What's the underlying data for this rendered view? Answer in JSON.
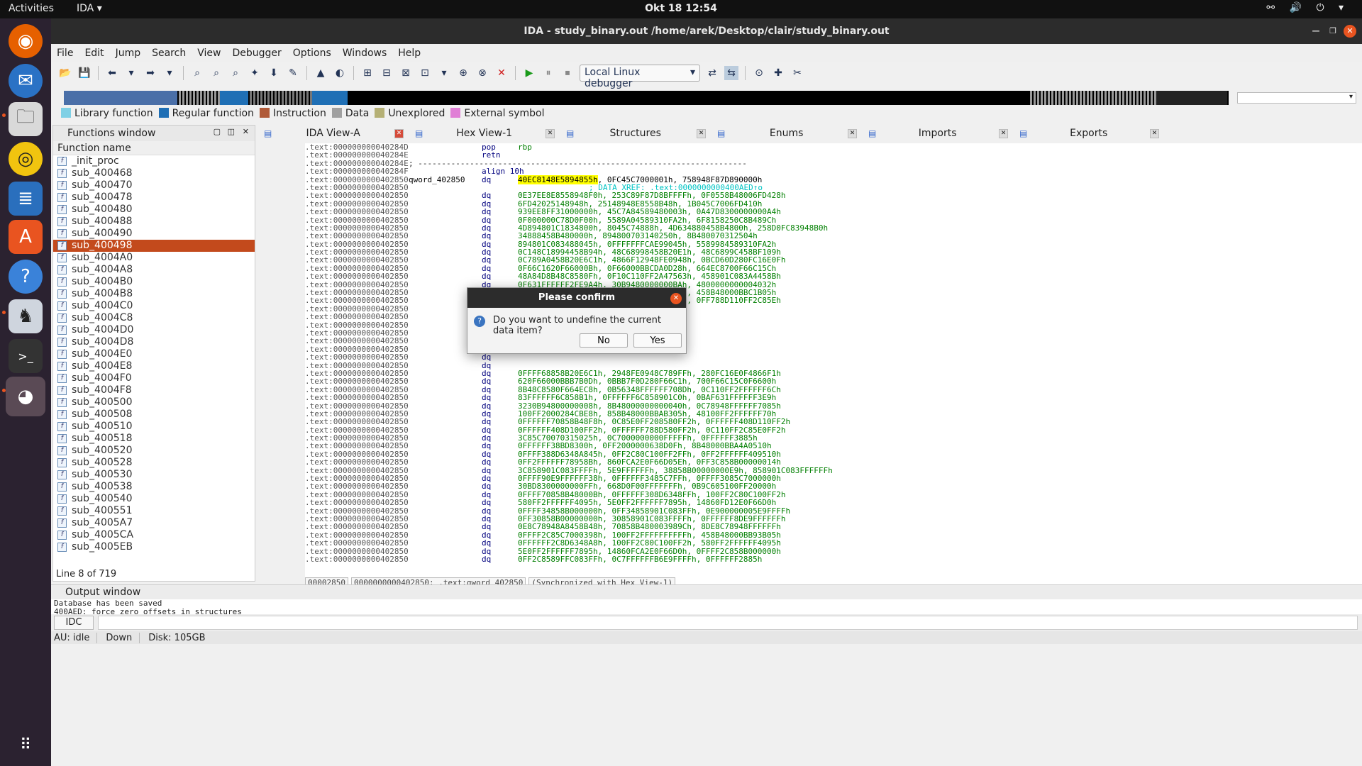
{
  "topbar": {
    "activities": "Activities",
    "app": "IDA ▾",
    "clock": "Okt 18  12:54",
    "tray": "⚯ 🔊 ⏻ ▾"
  },
  "window": {
    "title": "IDA - study_binary.out /home/arek/Desktop/clair/study_binary.out"
  },
  "menu": [
    "File",
    "Edit",
    "Jump",
    "Search",
    "View",
    "Debugger",
    "Options",
    "Windows",
    "Help"
  ],
  "toolbar": {
    "debugger": "Local Linux debugger"
  },
  "legend": [
    {
      "label": "Library function",
      "color": "#7fd0e5"
    },
    {
      "label": "Regular function",
      "color": "#1f6fb5"
    },
    {
      "label": "Instruction",
      "color": "#b05a38"
    },
    {
      "label": "Data",
      "color": "#a0a0a0"
    },
    {
      "label": "Unexplored",
      "color": "#b5b075"
    },
    {
      "label": "External symbol",
      "color": "#e07fd6"
    }
  ],
  "functions": {
    "title": "Functions window",
    "column": "Function name",
    "items": [
      "_init_proc",
      "sub_400468",
      "sub_400470",
      "sub_400478",
      "sub_400480",
      "sub_400488",
      "sub_400490",
      "sub_400498",
      "sub_4004A0",
      "sub_4004A8",
      "sub_4004B0",
      "sub_4004B8",
      "sub_4004C0",
      "sub_4004C8",
      "sub_4004D0",
      "sub_4004D8",
      "sub_4004E0",
      "sub_4004E8",
      "sub_4004F0",
      "sub_4004F8",
      "sub_400500",
      "sub_400508",
      "sub_400510",
      "sub_400518",
      "sub_400520",
      "sub_400528",
      "sub_400530",
      "sub_400538",
      "sub_400540",
      "sub_400551",
      "sub_4005A7",
      "sub_4005CA",
      "sub_4005EB"
    ],
    "selected_index": 7,
    "status": "Line 8 of 719"
  },
  "tabs": [
    {
      "label": "IDA View-A",
      "active": true
    },
    {
      "label": "Hex View-1",
      "active": false
    },
    {
      "label": "Structures",
      "active": false
    },
    {
      "label": "Enums",
      "active": false
    },
    {
      "label": "Imports",
      "active": false
    },
    {
      "label": "Exports",
      "active": false
    }
  ],
  "disasm": {
    "head": [
      {
        "addr": ".text:000000000040284D",
        "lab": "",
        "mn": "pop",
        "op": "rbp"
      },
      {
        "addr": ".text:000000000040284E",
        "lab": "",
        "mn": "retn",
        "op": ""
      },
      {
        "addr": ".text:000000000040284E",
        "lab": "",
        "mn": "; ----------------------------------------------------------------------",
        "op": ""
      },
      {
        "addr": ".text:000000000040284F",
        "lab": "",
        "mn": "align 10h",
        "op": ""
      }
    ],
    "qword_label": "qword_402850",
    "qword_addr": ".text:0000000000402850",
    "qword_first_hl": "40EC8148E5894855h",
    "qword_first_rest": ", 0FC45C7000001h, 758948F87D890000h",
    "xref": "; DATA XREF: .text:0000000000400AED↑o",
    "dq_addr": ".text:0000000000402850",
    "dq_lines": [
      "0E37EE8E8558948F0h, 253C89F87D8BFFFFh, 0F0558B48006FD428h",
      "6FD42025148948h, 25148948E8558B48h, 1B045C7006FD410h",
      "939EE8FF31000000h, 45C7A84589480003h, 0A47D8300000000A4h",
      "0F000000C78D0F00h, 5589A04589310FA2h, 6F8158250C8B489Ch",
      "4D894801C1834800h, 8045C74888h, 4D634880458B4800h, 258D0FC83948B0h",
      "34888458B480000h, 894800703140250h, 8B480070312504h",
      "894801C083488045h, 0FFFFFFFCAE99045h, 5589984589310FA2h",
      "0C148C18994458B94h, 48C68998458B20E1h, 48C6899C458BF109h",
      "0C789A0458B20E6C1h, 4866F12948FE0948h, 0BCD60D280FC16E0Fh",
      "0F66C1620F66000Bh, 0F66000BBCDA0D28h, 664EC8700F66C15Ch",
      "48A84D8B48C8580Fh, 0F10C110FF2A47563h, 458901C083A4458Bh",
      "0F631FFFFFF2FE9A4h, 30B9480000000BAh, 4800000000004032h",
      "35E8C78948A8458Bh, 100FF2FF3100028Bh, 458B48000BBC1B05h",
      "8B48F848100FF2A8h, 0FF208580FF2A845h, 0FF788D110FF2C85Eh",
      "",
      "",
      "",
      "",
      "",
      "",
      "",
      "",
      "0FFFF68858B20E6C1h, 2948FE0948C789FFh, 280FC16E0F4866F1h",
      "620F66000BBB7B0Dh, 0BBB7F0D280F66C1h, 700F66C15C0F6600h",
      "8B48C8580F664EC8h, 0B56348FFFFFF708Dh, 0C110FF2FFFFFF6Ch",
      "83FFFFFF6C858B1h, 0FFFFFF6C858901C0h, 0BAF631FFFFFF3E9h",
      "3230B94800000008h, 8B48000000000040h, 0C78948FFFFFF7085h",
      "100FF2000284CBE8h, 858B48000BBAB305h, 48100FF2FFFFFF70h",
      "0FFFFFF70858B48F8h, 0C85E0FF208580FF2h, 0FFFFFF408D110FF2h",
      "0FFFFFF408D100FF2h, 0FFFFFF788D580FF2h, 0C110FF2C85E0FF2h",
      "3C85C70070315025h, 0C7000000000FFFFFh, 0FFFFFF3885h",
      "0FFFFFF38BD8300h, 0FF2000000638D0Fh, 8B48000BBA4A0510h",
      "0FFFF388D6348A845h, 0FF2C80C100FF2FFh, 0FF2FFFFFF409510h",
      "0FF2FFFFFF78958Bh, 860FCA2E0F66D05Eh, 0FF3C858B00000014h",
      "3C858901C083FFFFh, 5E9FFFFFFh, 38858B00000000E9h, 858901C083FFFFFFh",
      "0FFFF90E9FFFFFF38h, 0FFFFFF3485C7FFh, 0FFFF3085C7000000h",
      "30BD8300000000FFh, 668D0F00FFFFFFFh, 0B9C605100FF20000h",
      "0FFFF70858B48000Bh, 0FFFFFF308D6348FFh, 100FF2C80C100FF2h",
      "580FF2FFFFFF4095h, 5E0FF2FFFFFF7895h, 14860FD12E0F66D0h",
      "0FFFF34858B000000h, 0FF34858901C083FFh, 0E900000005E9FFFFh",
      "0FF30858B00000000h, 30858901C083FFFFh, 0FFFFFF8DE9FFFFFFh",
      "0E8C78948A8458B48h, 70858B480003989Ch, 8DE8C78948FFFFFFh",
      "0FFFF2C85C7000398h, 100FF2FFFFFFFFFFh, 458B48000BB93B05h",
      "0FFFFFF2C8D6348A8h, 100FF2C80C100FF2h, 580FF2FFFFFF4095h",
      "5E0FF2FFFFFF7895h, 14860FCA2E0F66D0h, 0FFFF2C858B000000h",
      "0FF2C8589FFC083FFh, 0C7FFFFFFB6E9FFFFh, 0FFFFFF2885h"
    ],
    "status": [
      "00002850",
      "0000000000402850: .text:qword_402850",
      "(Synchronized with Hex View-1)"
    ]
  },
  "dialog": {
    "title": "Please confirm",
    "message": "Do you want to undefine the current data item?",
    "no": "No",
    "yes": "Yes"
  },
  "output": {
    "title": "Output window",
    "lines": [
      "Database has been saved",
      "400AED: force zero offsets in structures"
    ]
  },
  "idc": "IDC",
  "status": {
    "au": "AU:  idle",
    "dir": "Down",
    "disk": "Disk: 105GB"
  }
}
